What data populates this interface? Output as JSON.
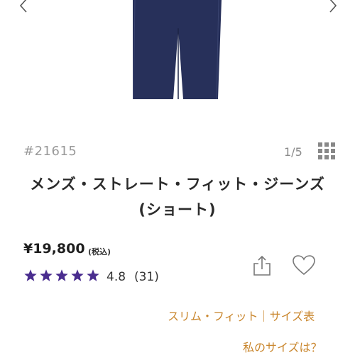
{
  "gallery": {
    "image": "navy-jeans-photo",
    "prev_icon": "chevron-left-icon",
    "next_icon": "chevron-right-icon"
  },
  "product": {
    "sku": "#21615",
    "image_counter": "1/5",
    "title_line1": "メンズ・ストレート・フィット・ジーンズ",
    "title_line2": "(ショート)",
    "price": "¥19,800",
    "tax_note": "(税込)",
    "rating_stars": 5,
    "rating": "4.8",
    "review_count": "(31)"
  },
  "links": {
    "fit": "スリム・フィット｜サイズ表",
    "my_size": "私のサイズは？"
  },
  "colors": {
    "star": "#4a2d8f",
    "link": "#c9862d",
    "jeans": "#27305a"
  }
}
